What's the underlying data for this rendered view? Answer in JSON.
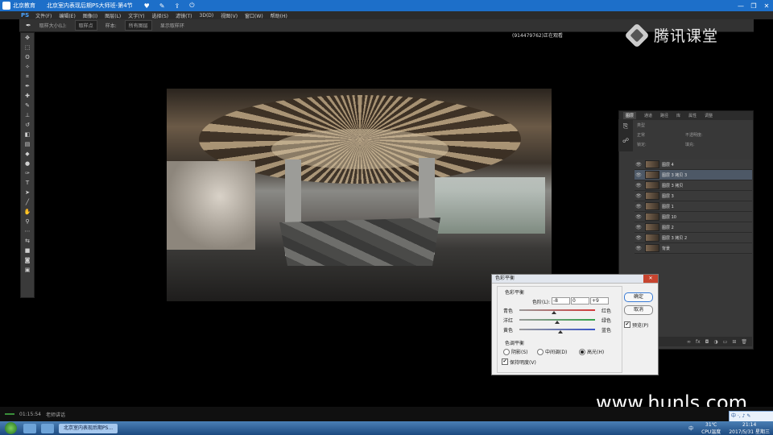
{
  "player": {
    "app_name": "北京教育",
    "lesson_title": "北京室内表现后期PS大师班-第4节",
    "window_buttons": [
      "—",
      "❐",
      "✕"
    ]
  },
  "ps_menu": {
    "logo": "PS",
    "items": [
      "文件(F)",
      "编辑(E)",
      "图像(I)",
      "图层(L)",
      "文字(Y)",
      "选择(S)",
      "滤镜(T)",
      "3D(D)",
      "视图(V)",
      "窗口(W)",
      "帮助(H)"
    ]
  },
  "options_bar": {
    "sample_size_label": "取样大小(L):",
    "sample_size_value": "取样点",
    "sample_label": "样本:",
    "sample_value": "所有图层",
    "ring_label": "显示取样环"
  },
  "watcher_text": "(914479762)正在观看",
  "tencent_label": "腾讯课堂",
  "layers_panel": {
    "tabs": [
      "图层",
      "通道",
      "路径",
      "库",
      "属性",
      "调整"
    ],
    "search_placeholder": "类型",
    "blend_mode": "正常",
    "opacity_label": "不透明度:",
    "fill_label": "填充:",
    "lock_label": "锁定:",
    "layers": [
      {
        "name": "图层 4",
        "selected": false
      },
      {
        "name": "图层 3 拷贝 3",
        "selected": true
      },
      {
        "name": "图层 3 拷贝",
        "selected": false
      },
      {
        "name": "图层 3",
        "selected": false
      },
      {
        "name": "图层 1",
        "selected": false
      },
      {
        "name": "图层 10",
        "selected": false
      },
      {
        "name": "图层 2",
        "selected": false
      },
      {
        "name": "图层 3 拷贝 2",
        "selected": false
      },
      {
        "name": "背景",
        "selected": false
      }
    ],
    "footer_icons": [
      "link-icon",
      "fx-icon",
      "mask-icon",
      "adjust-icon",
      "folder-icon",
      "new-layer-icon",
      "trash-icon"
    ]
  },
  "color_balance": {
    "title": "色彩平衡",
    "group_title": "色彩平衡",
    "levels_label": "色阶(L):",
    "levels": [
      "-8",
      "0",
      "+9"
    ],
    "sliders": [
      {
        "left": "青色",
        "right": "红色",
        "value": -8,
        "color": "#d13a3a"
      },
      {
        "left": "洋红",
        "right": "绿色",
        "value": 0,
        "color": "#32a24a"
      },
      {
        "left": "黄色",
        "right": "蓝色",
        "value": 9,
        "color": "#3a56c8"
      }
    ],
    "tone_group_title": "色调平衡",
    "tones": [
      {
        "label": "阴影(S)",
        "checked": false
      },
      {
        "label": "中间调(D)",
        "checked": false
      },
      {
        "label": "高光(H)",
        "checked": true
      }
    ],
    "preserve_label": "保持明度(V)",
    "preserve_checked": true,
    "ok_label": "确定",
    "cancel_label": "取消",
    "preview_label": "预览(P)",
    "preview_checked": true
  },
  "watermark_url": "www.hunls.com",
  "time_bar": {
    "elapsed": "01:15:54",
    "teacher_label": "老师讲话"
  },
  "taskbar": {
    "task_label": "北京室内表现后期PS...",
    "tray": {
      "input_method": "中",
      "temp": "31℃",
      "temp_label": "CPU温度",
      "time": "21:14",
      "date": "2017/5/31 星期三"
    }
  },
  "ime_label": "中 ·, ♪ ✎"
}
